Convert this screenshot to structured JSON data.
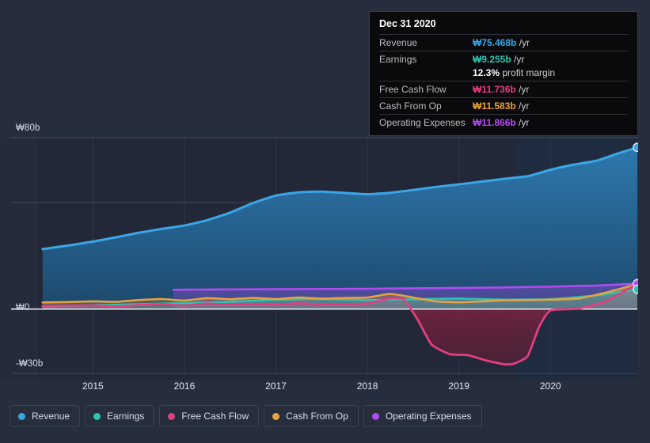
{
  "chart_data": {
    "type": "area",
    "title": "",
    "xlabel": "",
    "ylabel": "",
    "currency_symbol": "₩",
    "x_tick_labels": [
      "2015",
      "2016",
      "2017",
      "2018",
      "2019",
      "2020"
    ],
    "y_tick_labels": [
      "₩80b",
      "₩0",
      "-₩30b"
    ],
    "ylim": [
      -30,
      80
    ],
    "xlim": [
      2014.4,
      2020.95
    ],
    "grid": true,
    "legend_position": "bottom",
    "series": [
      {
        "name": "Revenue",
        "color": "#3aa6e8",
        "x": [
          2014.45,
          2014.75,
          2015.0,
          2015.25,
          2015.5,
          2015.75,
          2016.0,
          2016.25,
          2016.5,
          2016.75,
          2017.0,
          2017.25,
          2017.5,
          2017.75,
          2018.0,
          2018.25,
          2018.5,
          2018.75,
          2019.0,
          2019.25,
          2019.5,
          2019.75,
          2020.0,
          2020.25,
          2020.5,
          2020.75,
          2020.95
        ],
        "values": [
          28.0,
          29.8,
          31.5,
          33.5,
          35.6,
          37.4,
          39.0,
          41.5,
          45.0,
          49.5,
          53.0,
          54.5,
          54.8,
          54.2,
          53.6,
          54.3,
          55.6,
          57.0,
          58.2,
          59.5,
          60.8,
          62.0,
          65.0,
          67.4,
          69.2,
          72.8,
          75.468
        ]
      },
      {
        "name": "Earnings",
        "color": "#2ec4b0",
        "x": [
          2014.45,
          2014.75,
          2015.0,
          2015.5,
          2016.0,
          2016.5,
          2017.0,
          2017.5,
          2018.0,
          2018.5,
          2019.0,
          2019.5,
          2020.0,
          2020.5,
          2020.95
        ],
        "values": [
          1.2,
          1.5,
          1.8,
          2.3,
          2.8,
          3.4,
          4.4,
          4.7,
          4.2,
          4.6,
          4.9,
          4.4,
          4.6,
          6.4,
          9.255
        ]
      },
      {
        "name": "Free Cash Flow",
        "color": "#e0407f",
        "x": [
          2014.45,
          2014.75,
          2015.0,
          2015.25,
          2015.5,
          2015.75,
          2016.0,
          2016.25,
          2016.5,
          2016.75,
          2017.0,
          2017.25,
          2017.5,
          2017.75,
          2018.0,
          2018.25,
          2018.4,
          2018.55,
          2018.7,
          2018.9,
          2019.1,
          2019.3,
          2019.5,
          2019.6,
          2019.75,
          2019.88,
          2020.0,
          2020.3,
          2020.6,
          2020.95
        ],
        "values": [
          1.5,
          1.6,
          1.7,
          1.2,
          1.9,
          2.4,
          1.6,
          2.6,
          1.9,
          2.4,
          2.0,
          2.7,
          2.1,
          2.2,
          2.6,
          5.0,
          4.4,
          -5.0,
          -16.5,
          -21.0,
          -21.5,
          -24.0,
          -25.8,
          -25.5,
          -22.0,
          -8.0,
          -0.6,
          0.2,
          3.5,
          11.736
        ]
      },
      {
        "name": "Cash From Op",
        "color": "#e8a33d",
        "x": [
          2014.45,
          2014.75,
          2015.0,
          2015.25,
          2015.5,
          2015.75,
          2016.0,
          2016.25,
          2016.5,
          2016.75,
          2017.0,
          2017.25,
          2017.5,
          2017.75,
          2018.0,
          2018.25,
          2018.5,
          2018.75,
          2019.0,
          2019.25,
          2019.5,
          2019.75,
          2020.0,
          2020.3,
          2020.6,
          2020.95
        ],
        "values": [
          3.1,
          3.3,
          3.6,
          3.4,
          4.2,
          4.7,
          4.0,
          5.1,
          4.6,
          5.2,
          4.7,
          5.4,
          4.9,
          5.2,
          5.4,
          7.1,
          5.4,
          3.6,
          3.2,
          3.6,
          4.1,
          4.2,
          4.4,
          4.9,
          7.6,
          11.583
        ]
      },
      {
        "name": "Operating Expenses",
        "color": "#b14bf0",
        "x": [
          2015.88,
          2016.1,
          2016.5,
          2017.0,
          2017.5,
          2018.0,
          2018.5,
          2019.0,
          2019.5,
          2020.0,
          2020.5,
          2020.95
        ],
        "values": [
          9.0,
          9.1,
          9.2,
          9.3,
          9.4,
          9.5,
          9.7,
          9.9,
          10.1,
          10.5,
          11.0,
          11.866
        ]
      }
    ]
  },
  "tooltip": {
    "date": "Dec 31 2020",
    "unit_suffix": "/yr",
    "rows": [
      {
        "label": "Revenue",
        "value": "₩75.468b",
        "unit": "/yr",
        "color_key": "c-rev"
      },
      {
        "label": "Earnings",
        "value": "₩9.255b",
        "unit": "/yr",
        "color_key": "c-earn"
      },
      {
        "label": "",
        "value": "12.3%",
        "unit": "profit margin",
        "color_key": "c-white"
      },
      {
        "label": "Free Cash Flow",
        "value": "₩11.736b",
        "unit": "/yr",
        "color_key": "c-fcf"
      },
      {
        "label": "Cash From Op",
        "value": "₩11.583b",
        "unit": "/yr",
        "color_key": "c-cfo"
      },
      {
        "label": "Operating Expenses",
        "value": "₩11.866b",
        "unit": "/yr",
        "color_key": "c-opex"
      }
    ]
  },
  "legend": {
    "items": [
      {
        "label": "Revenue",
        "color": "#3aa6e8"
      },
      {
        "label": "Earnings",
        "color": "#2ec4b0"
      },
      {
        "label": "Free Cash Flow",
        "color": "#e0407f"
      },
      {
        "label": "Cash From Op",
        "color": "#e8a33d"
      },
      {
        "label": "Operating Expenses",
        "color": "#b14bf0"
      }
    ]
  },
  "axes": {
    "y_ticks": [
      {
        "label": "₩80b",
        "value": 80
      },
      {
        "label": "₩0",
        "value": 0
      },
      {
        "label": "-₩30b",
        "value": -30
      }
    ],
    "x_ticks": [
      {
        "label": "2015",
        "value": 2015
      },
      {
        "label": "2016",
        "value": 2016
      },
      {
        "label": "2017",
        "value": 2017
      },
      {
        "label": "2018",
        "value": 2018
      },
      {
        "label": "2019",
        "value": 2019
      },
      {
        "label": "2020",
        "value": 2020
      }
    ]
  }
}
